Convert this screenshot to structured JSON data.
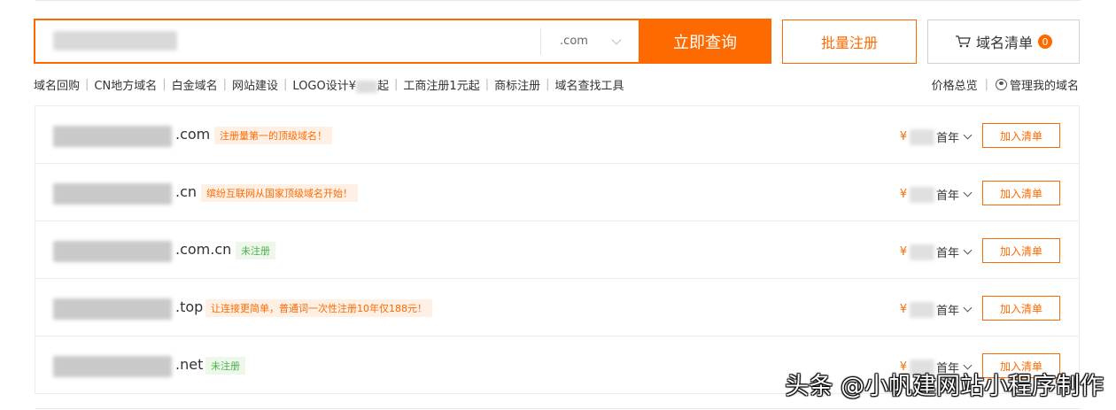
{
  "search": {
    "value": "",
    "tld": ".com",
    "button_label": "立即查询"
  },
  "bulk_register_label": "批量注册",
  "cart": {
    "label": "域名清单",
    "count": "0"
  },
  "quick_links": [
    "域名回购",
    "CN地方域名",
    "白金域名",
    "网站建设",
    "LOGO设计¥",
    "工商注册1元起",
    "商标注册",
    "域名查找工具"
  ],
  "quick_link_logo_tail": "起",
  "right_links": {
    "price_overview": "价格总览",
    "manage": "管理我的域名"
  },
  "results": [
    {
      "suffix": ".com",
      "tag": "注册量第一的顶级域名！",
      "tag_type": "promo",
      "price_prefix": "¥",
      "period": "首年",
      "add_label": "加入清单"
    },
    {
      "suffix": ".cn",
      "tag": "缤纷互联网从国家顶级域名开始！",
      "tag_type": "promo",
      "price_prefix": "¥",
      "period": "首年",
      "add_label": "加入清单"
    },
    {
      "suffix": ".com.cn",
      "tag": "未注册",
      "tag_type": "status",
      "price_prefix": "¥",
      "period": "首年",
      "add_label": "加入清单"
    },
    {
      "suffix": ".top",
      "tag": "让连接更简单，普通词一次性注册10年仅188元！",
      "tag_type": "promo",
      "price_prefix": "¥",
      "period": "首年",
      "add_label": "加入清单"
    },
    {
      "suffix": ".net",
      "tag": "未注册",
      "tag_type": "status",
      "price_prefix": "¥",
      "period": "首年",
      "add_label": "加入清单"
    }
  ],
  "watermark": "头条 @小帆建网站小程序制作",
  "colors": {
    "accent": "#ff6a00",
    "status_green": "#4caf50"
  }
}
